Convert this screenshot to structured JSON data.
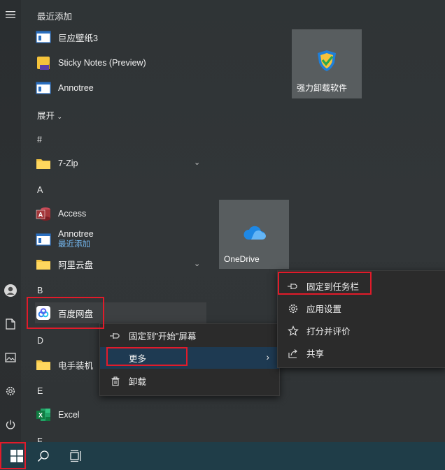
{
  "recent": {
    "header": "最近添加",
    "apps": [
      "巨应壁纸3",
      "Sticky Notes (Preview)",
      "Annotree"
    ]
  },
  "expand_label": "展开",
  "groups": {
    "hash": "#",
    "a": "A",
    "b": "B",
    "d": "D",
    "e": "E",
    "f": "F"
  },
  "apps": {
    "zip": "7-Zip",
    "access": "Access",
    "annotree": "Annotree",
    "annotree_sub": "最近添加",
    "aliyun": "阿里云盘",
    "baidu": "百度网盘",
    "dianshou": "电手装机",
    "excel": "Excel"
  },
  "tiles": {
    "uninstall": "强力卸载软件",
    "onedrive": "OneDrive"
  },
  "context_menu": {
    "pin_start": "固定到\"开始\"屏幕",
    "more": "更多",
    "uninstall": "卸载"
  },
  "submenu": {
    "pin_taskbar": "固定到任务栏",
    "app_settings": "应用设置",
    "rate_review": "打分并评价",
    "share": "共享"
  },
  "colors": {
    "highlight_red": "#e11b2a",
    "menu_highlight": "#1e3a52",
    "taskbar": "#1f3d48",
    "accent_blue": "#74b8f0"
  }
}
